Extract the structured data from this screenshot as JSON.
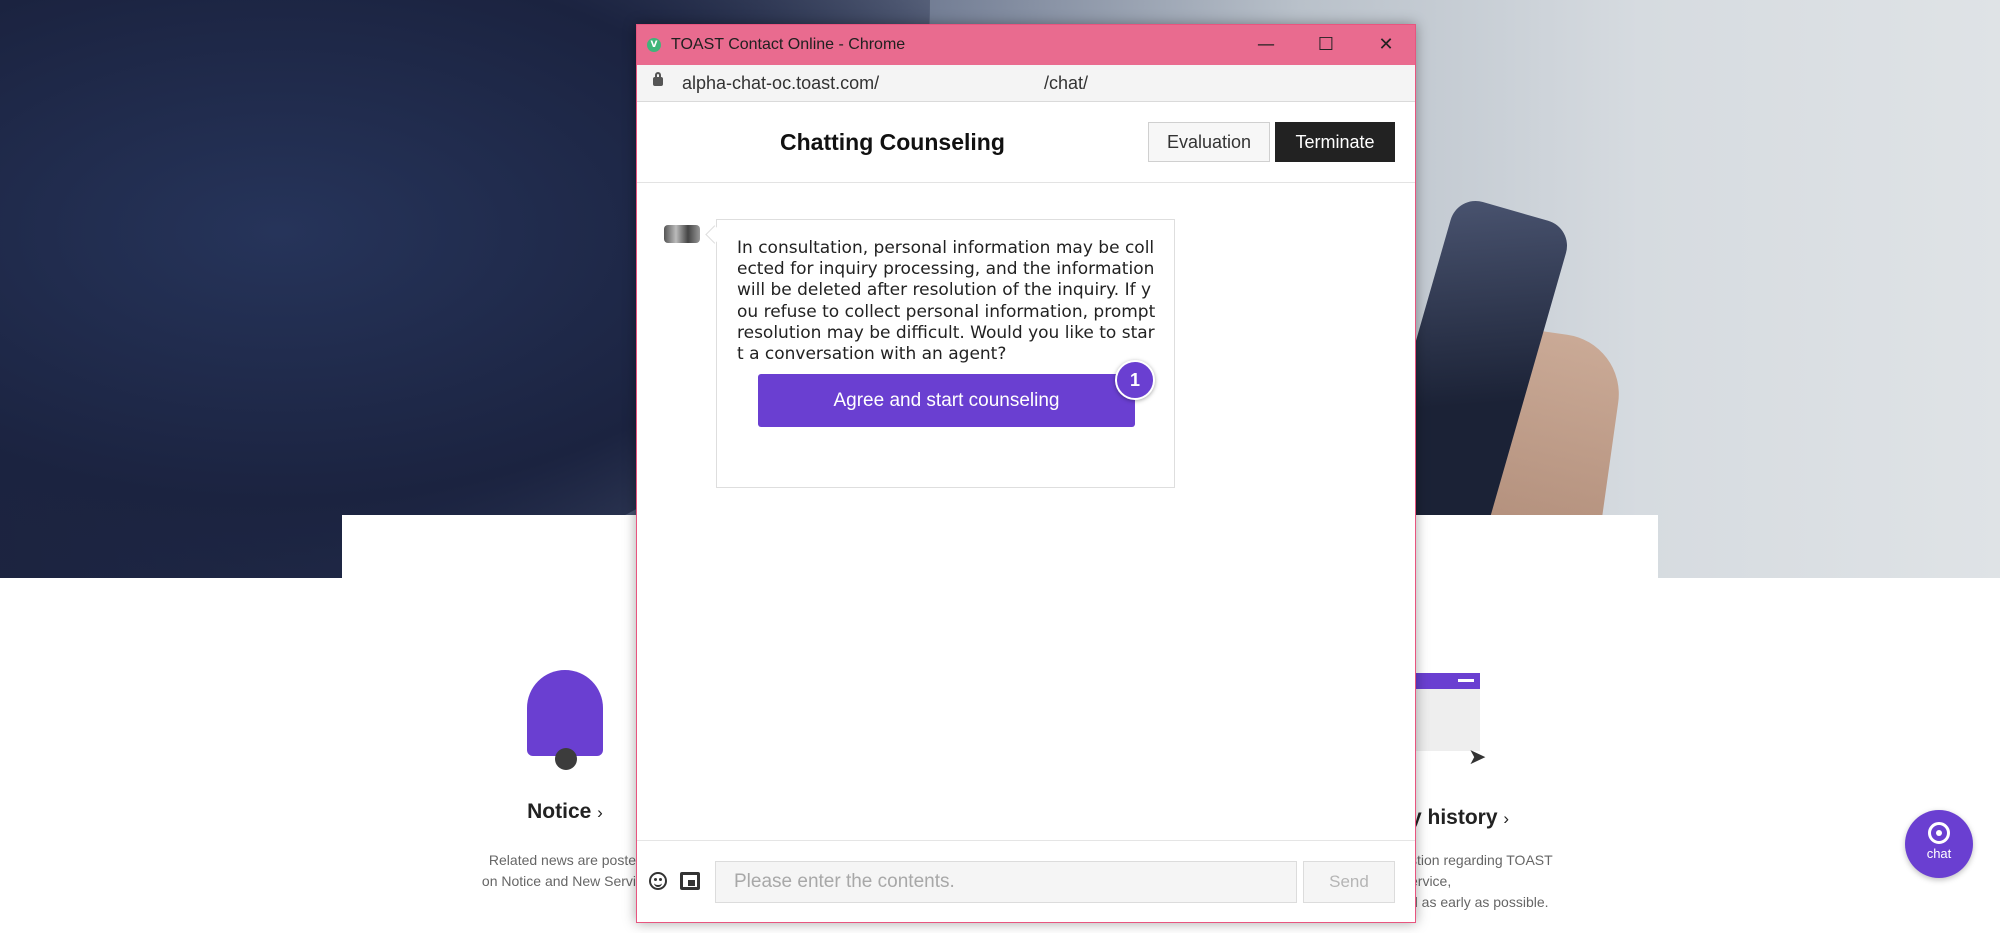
{
  "window": {
    "title": "TOAST Contact Online - Chrome",
    "favicon_letter": "V",
    "url_part1": "alpha-chat-oc.toast.com/",
    "url_part2": "/chat/"
  },
  "chat": {
    "title": "Chatting Counseling",
    "evaluation_label": "Evaluation",
    "terminate_label": "Terminate",
    "message": "In consultation, personal information may be collected for inquiry processing, and the information will be deleted after resolution of the inquiry. If you refuse to collect personal information, prompt resolution may be difficult. Would you like to start a conversation with an agent?",
    "agree_label": "Agree and start counseling",
    "badge_count": "1",
    "input_placeholder": "Please enter the contents.",
    "send_label": "Send"
  },
  "background": {
    "notice_title": "Notice",
    "notice_desc_line1": "Related news are poste",
    "notice_desc_line2": "on Notice and New Servi",
    "history_title": "y history",
    "history_desc_line1": "stion regarding TOAST",
    "history_desc_line2": "ervice,",
    "history_desc_line3": "d as early as possible.",
    "chat_fab_label": "chat"
  },
  "colors": {
    "accent": "#6a3fd1",
    "titlebar": "#e96b8f",
    "terminate_bg": "#222222"
  },
  "icons": {
    "bell": "bell-icon",
    "history": "window-cursor-icon",
    "emoji": "emoji-icon",
    "attach": "image-attach-icon",
    "lock": "lock-icon",
    "chat": "chat-bubble-icon"
  }
}
